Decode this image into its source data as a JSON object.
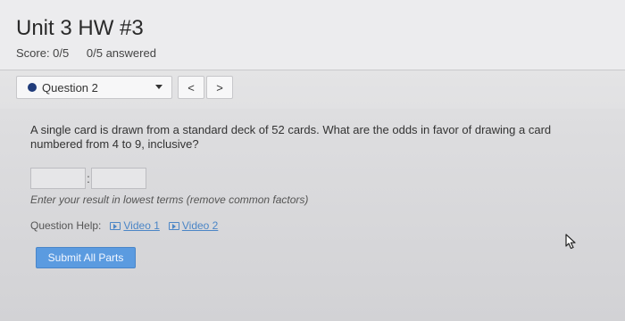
{
  "header": {
    "title": "Unit 3 HW #3",
    "score": "Score: 0/5",
    "answered": "0/5 answered"
  },
  "question_nav": {
    "label": "Question 2",
    "prev": "<",
    "next": ">"
  },
  "question": {
    "text": "A single card is drawn from a standard deck of 52 cards. What are the odds in favor of drawing a card numbered from 4 to 9, inclusive?",
    "answer_left": "",
    "answer_right": "",
    "separator": ":",
    "hint": "Enter your result in lowest terms (remove common factors)"
  },
  "help": {
    "label": "Question Help:",
    "videos": [
      "Video 1",
      "Video 2"
    ]
  },
  "actions": {
    "submit": "Submit All Parts"
  },
  "colors": {
    "accent": "#5b9be0",
    "link": "#4c86c6",
    "dot": "#1f3b7a"
  },
  "icons": [
    "play-icon",
    "mouse-pointer-icon"
  ]
}
